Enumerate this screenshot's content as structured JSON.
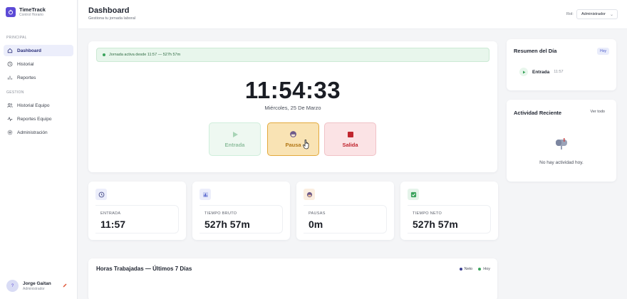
{
  "app": {
    "name": "TimeTrack",
    "subtitle": "Control Horario"
  },
  "sidebar": {
    "section_principal": "PRINCIPAL",
    "section_gestion": "GESTION",
    "items": [
      {
        "label": "Dashboard",
        "icon": "home-icon",
        "active": true
      },
      {
        "label": "Historial",
        "icon": "clock-icon"
      },
      {
        "label": "Reportes",
        "icon": "bar-chart-icon"
      },
      {
        "label": "Historial Equipo",
        "icon": "users-icon"
      },
      {
        "label": "Reportes Equipo",
        "icon": "activity-icon"
      },
      {
        "label": "Administración",
        "icon": "gear-icon"
      }
    ],
    "user": {
      "initial": "?",
      "name": "Jorge Gaitan",
      "role": "Administrador"
    }
  },
  "header": {
    "title": "Dashboard",
    "subtitle": "Gestiona tu jornada laboral",
    "rol_label": "Rol:",
    "rol_value": "Administrador"
  },
  "clock_card": {
    "status": "Jornada activa desde 11:57 — 527h 57m",
    "time": "11:54:33",
    "date": "Miércoles, 25 De Marzo",
    "buttons": {
      "entrada": "Entrada",
      "pausa": "Pausa",
      "salida": "Salida"
    }
  },
  "resumen": {
    "title": "Resumen del Día",
    "badge": "Hoy",
    "entry_label": "Entrada",
    "entry_time": "11:57"
  },
  "actividad": {
    "title": "Actividad Reciente",
    "link": "Ver todo",
    "empty": "No hay actividad hoy."
  },
  "stats": [
    {
      "label": "ENTRADA",
      "value": "11:57",
      "icon": "clock-icon"
    },
    {
      "label": "TIEMPO BRUTO",
      "value": "527h 57m",
      "icon": "bar-chart-icon"
    },
    {
      "label": "PAUSAS",
      "value": "0m",
      "icon": "coffee-icon"
    },
    {
      "label": "TIEMPO NETO",
      "value": "527h 57m",
      "icon": "check-icon"
    }
  ],
  "chart": {
    "title": "Horas Trabajadas — Últimos 7 Días",
    "legend": [
      {
        "name": "Neto",
        "color": "#3b3f8f"
      },
      {
        "name": "Hoy",
        "color": "#3aa35c"
      }
    ]
  },
  "colors": {
    "accent": "#5c4ad6",
    "success": "#3aa35c",
    "warning": "#e3a93c",
    "danger": "#c0262f"
  }
}
